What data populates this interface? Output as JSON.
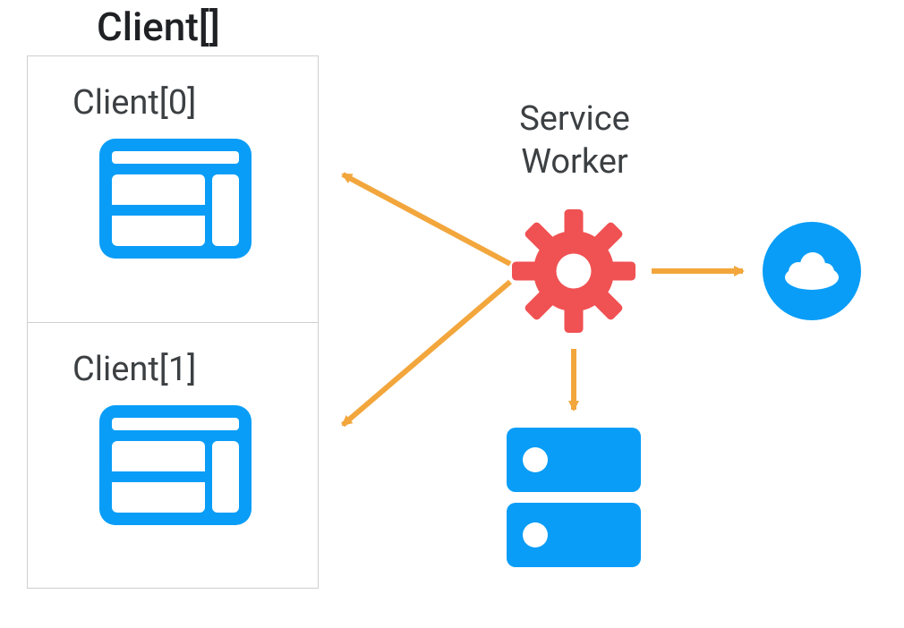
{
  "title": "Client[]",
  "clients": [
    {
      "label": "Client[0]"
    },
    {
      "label": "Client[1]"
    }
  ],
  "serviceWorker": {
    "label": "Service Worker"
  },
  "colors": {
    "blue": "#099DF7",
    "red": "#F05152",
    "orange": "#F2A63C",
    "text": "#3c4043",
    "border": "#cfcfcf"
  },
  "arrows": [
    {
      "from": "service-worker",
      "to": "client-0"
    },
    {
      "from": "service-worker",
      "to": "client-1"
    },
    {
      "from": "service-worker",
      "to": "cloud"
    },
    {
      "from": "service-worker",
      "to": "cache-server"
    }
  ]
}
